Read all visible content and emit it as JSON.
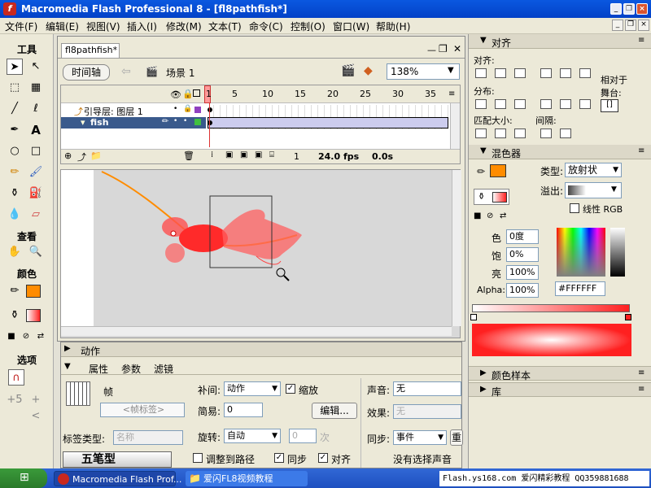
{
  "window": {
    "title": "Macromedia Flash Professional 8 - [fl8pathfish*]"
  },
  "menu": [
    "文件(F)",
    "编辑(E)",
    "视图(V)",
    "插入(I)",
    "修改(M)",
    "文本(T)",
    "命令(C)",
    "控制(O)",
    "窗口(W)",
    "帮助(H)"
  ],
  "toolbox": {
    "tools_label": "工具",
    "view_label": "查看",
    "colors_label": "颜色",
    "options_label": "选项"
  },
  "document": {
    "tab": "fl8pathfish*",
    "timeline_btn": "时间轴",
    "scene": "场景 1",
    "zoom": "138%",
    "frame_numbers": [
      "1",
      "5",
      "10",
      "15",
      "20",
      "25",
      "30",
      "35"
    ],
    "layers": [
      {
        "name": "引导层: 图层 1"
      },
      {
        "name": "fish"
      }
    ],
    "status": {
      "frame": "1",
      "fps": "24.0 fps",
      "time": "0.0s"
    }
  },
  "props": {
    "actions_label": "动作",
    "tabs": [
      "属性",
      "参数",
      "滤镜"
    ],
    "frame_label": "帧",
    "frame_name_placeholder": "<帧标签>",
    "label_type_label": "标签类型:",
    "label_type_value": "名称",
    "tween_label": "补间:",
    "tween_value": "动作",
    "scale_label": "缩放",
    "ease_label": "简易:",
    "ease_value": "0",
    "edit_btn": "编辑...",
    "rotate_label": "旋转:",
    "rotate_value": "自动",
    "rotate_times": "0",
    "times_label": "次",
    "orient_label": "调整到路径",
    "sync_label": "同步",
    "snap_label": "对齐",
    "sound_label": "声音:",
    "sound_value": "无",
    "effect_label": "效果:",
    "effect_value": "无",
    "sync2_label": "同步:",
    "sync2_value": "事件",
    "repeat_btn": "重",
    "no_sound": "没有选择声音",
    "logo_text": "五笔型"
  },
  "align_panel": {
    "title": "对齐",
    "align_label": "对齐:",
    "distribute_label": "分布:",
    "match_label": "匹配大小:",
    "space_label": "间隔:",
    "relative_label": "相对于\n舞台:"
  },
  "mixer_panel": {
    "title": "混色器",
    "type_label": "类型:",
    "type_value": "放射状",
    "overflow_label": "溢出:",
    "linear_rgb": "线性 RGB",
    "hue_label": "色",
    "hue_value": "0度",
    "sat_label": "饱",
    "sat_value": "0%",
    "bright_label": "亮",
    "bright_value": "100%",
    "alpha_label": "Alpha:",
    "alpha_value": "100%",
    "hex": "#FFFFFF"
  },
  "swatches_panel": {
    "title": "颜色样本"
  },
  "library_panel": {
    "title": "库"
  },
  "taskbar": {
    "tasks": [
      "Macromedia Flash Prof...",
      "爱闪FL8视频教程"
    ],
    "tray": "Flash.ys168.com 爱闪精彩教程 QQ359881688"
  },
  "colors": {
    "title_blue": "#0a58e0",
    "stroke": "#ff8c00",
    "fill_red": "#ff2020",
    "task_blue": "#3168d5"
  }
}
